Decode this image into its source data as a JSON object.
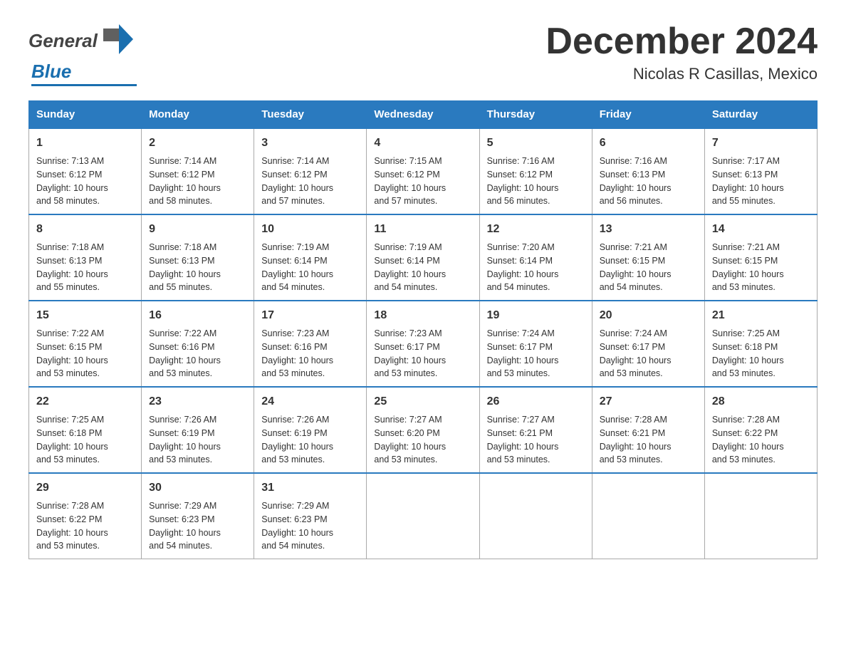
{
  "header": {
    "month_title": "December 2024",
    "location": "Nicolas R Casillas, Mexico"
  },
  "days_of_week": [
    "Sunday",
    "Monday",
    "Tuesday",
    "Wednesday",
    "Thursday",
    "Friday",
    "Saturday"
  ],
  "weeks": [
    [
      {
        "day": "1",
        "sunrise": "7:13 AM",
        "sunset": "6:12 PM",
        "daylight": "10 hours and 58 minutes."
      },
      {
        "day": "2",
        "sunrise": "7:14 AM",
        "sunset": "6:12 PM",
        "daylight": "10 hours and 58 minutes."
      },
      {
        "day": "3",
        "sunrise": "7:14 AM",
        "sunset": "6:12 PM",
        "daylight": "10 hours and 57 minutes."
      },
      {
        "day": "4",
        "sunrise": "7:15 AM",
        "sunset": "6:12 PM",
        "daylight": "10 hours and 57 minutes."
      },
      {
        "day": "5",
        "sunrise": "7:16 AM",
        "sunset": "6:12 PM",
        "daylight": "10 hours and 56 minutes."
      },
      {
        "day": "6",
        "sunrise": "7:16 AM",
        "sunset": "6:13 PM",
        "daylight": "10 hours and 56 minutes."
      },
      {
        "day": "7",
        "sunrise": "7:17 AM",
        "sunset": "6:13 PM",
        "daylight": "10 hours and 55 minutes."
      }
    ],
    [
      {
        "day": "8",
        "sunrise": "7:18 AM",
        "sunset": "6:13 PM",
        "daylight": "10 hours and 55 minutes."
      },
      {
        "day": "9",
        "sunrise": "7:18 AM",
        "sunset": "6:13 PM",
        "daylight": "10 hours and 55 minutes."
      },
      {
        "day": "10",
        "sunrise": "7:19 AM",
        "sunset": "6:14 PM",
        "daylight": "10 hours and 54 minutes."
      },
      {
        "day": "11",
        "sunrise": "7:19 AM",
        "sunset": "6:14 PM",
        "daylight": "10 hours and 54 minutes."
      },
      {
        "day": "12",
        "sunrise": "7:20 AM",
        "sunset": "6:14 PM",
        "daylight": "10 hours and 54 minutes."
      },
      {
        "day": "13",
        "sunrise": "7:21 AM",
        "sunset": "6:15 PM",
        "daylight": "10 hours and 54 minutes."
      },
      {
        "day": "14",
        "sunrise": "7:21 AM",
        "sunset": "6:15 PM",
        "daylight": "10 hours and 53 minutes."
      }
    ],
    [
      {
        "day": "15",
        "sunrise": "7:22 AM",
        "sunset": "6:15 PM",
        "daylight": "10 hours and 53 minutes."
      },
      {
        "day": "16",
        "sunrise": "7:22 AM",
        "sunset": "6:16 PM",
        "daylight": "10 hours and 53 minutes."
      },
      {
        "day": "17",
        "sunrise": "7:23 AM",
        "sunset": "6:16 PM",
        "daylight": "10 hours and 53 minutes."
      },
      {
        "day": "18",
        "sunrise": "7:23 AM",
        "sunset": "6:17 PM",
        "daylight": "10 hours and 53 minutes."
      },
      {
        "day": "19",
        "sunrise": "7:24 AM",
        "sunset": "6:17 PM",
        "daylight": "10 hours and 53 minutes."
      },
      {
        "day": "20",
        "sunrise": "7:24 AM",
        "sunset": "6:17 PM",
        "daylight": "10 hours and 53 minutes."
      },
      {
        "day": "21",
        "sunrise": "7:25 AM",
        "sunset": "6:18 PM",
        "daylight": "10 hours and 53 minutes."
      }
    ],
    [
      {
        "day": "22",
        "sunrise": "7:25 AM",
        "sunset": "6:18 PM",
        "daylight": "10 hours and 53 minutes."
      },
      {
        "day": "23",
        "sunrise": "7:26 AM",
        "sunset": "6:19 PM",
        "daylight": "10 hours and 53 minutes."
      },
      {
        "day": "24",
        "sunrise": "7:26 AM",
        "sunset": "6:19 PM",
        "daylight": "10 hours and 53 minutes."
      },
      {
        "day": "25",
        "sunrise": "7:27 AM",
        "sunset": "6:20 PM",
        "daylight": "10 hours and 53 minutes."
      },
      {
        "day": "26",
        "sunrise": "7:27 AM",
        "sunset": "6:21 PM",
        "daylight": "10 hours and 53 minutes."
      },
      {
        "day": "27",
        "sunrise": "7:28 AM",
        "sunset": "6:21 PM",
        "daylight": "10 hours and 53 minutes."
      },
      {
        "day": "28",
        "sunrise": "7:28 AM",
        "sunset": "6:22 PM",
        "daylight": "10 hours and 53 minutes."
      }
    ],
    [
      {
        "day": "29",
        "sunrise": "7:28 AM",
        "sunset": "6:22 PM",
        "daylight": "10 hours and 53 minutes."
      },
      {
        "day": "30",
        "sunrise": "7:29 AM",
        "sunset": "6:23 PM",
        "daylight": "10 hours and 54 minutes."
      },
      {
        "day": "31",
        "sunrise": "7:29 AM",
        "sunset": "6:23 PM",
        "daylight": "10 hours and 54 minutes."
      },
      null,
      null,
      null,
      null
    ]
  ],
  "labels": {
    "sunrise": "Sunrise:",
    "sunset": "Sunset:",
    "daylight": "Daylight:"
  }
}
